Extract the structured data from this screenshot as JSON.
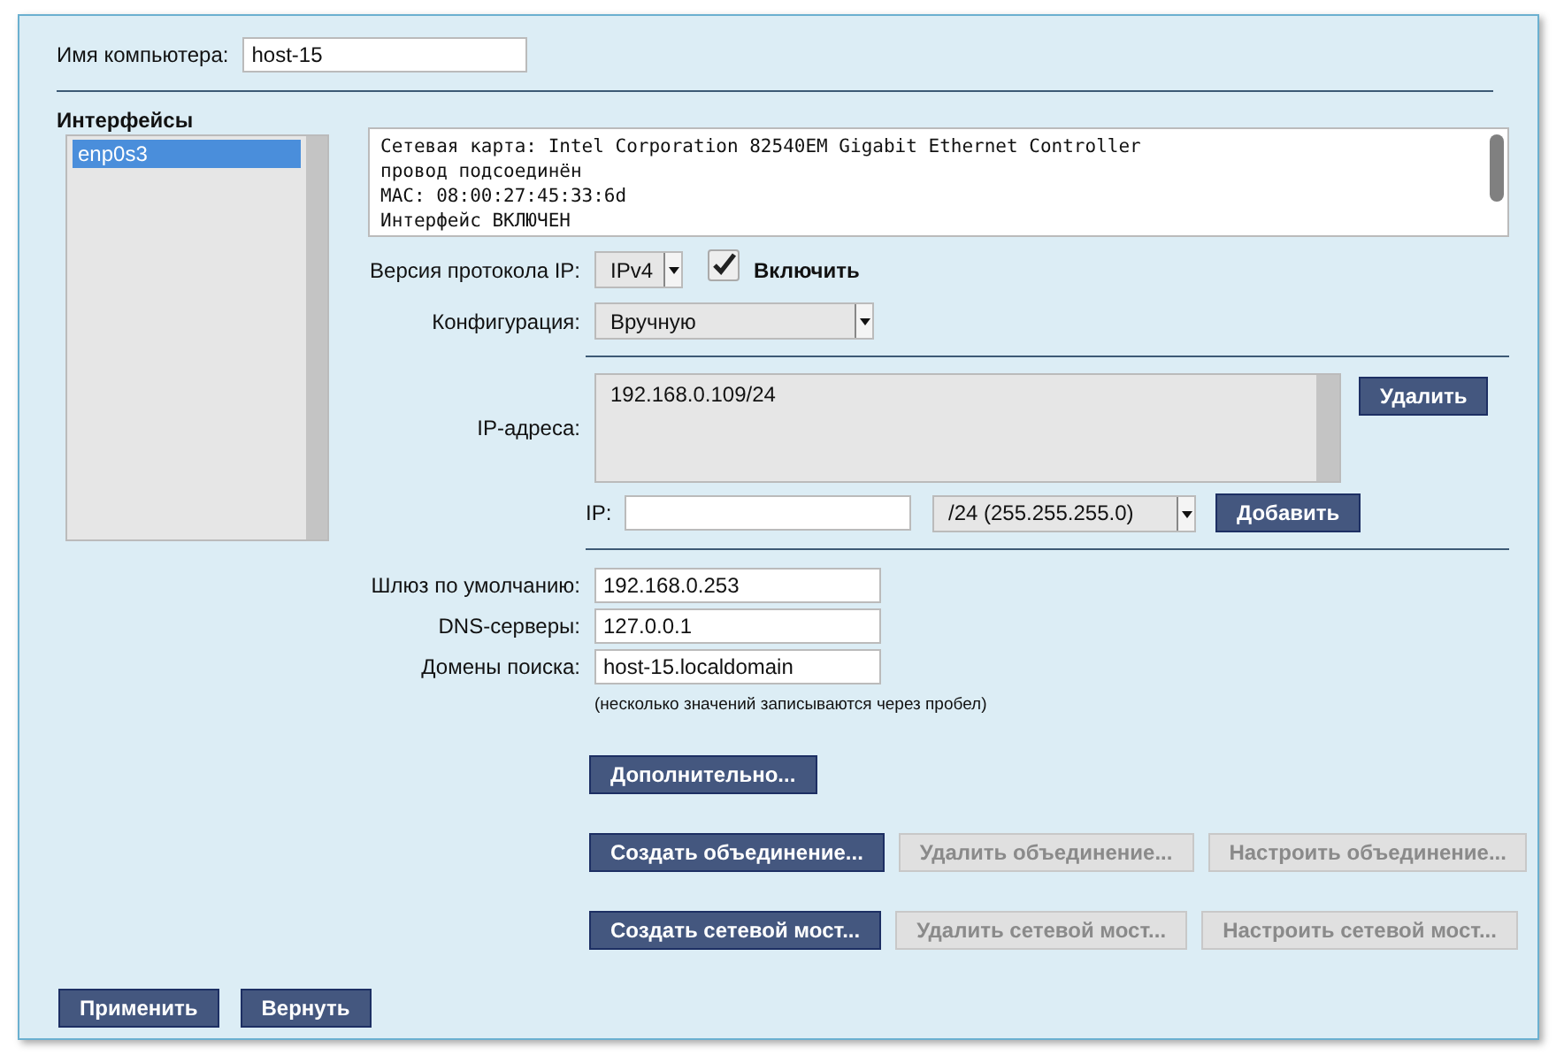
{
  "hostname": {
    "label": "Имя компьютера:",
    "value": "host-15"
  },
  "interfaces": {
    "title": "Интерфейсы",
    "items": [
      {
        "label": "enp0s3",
        "selected": true
      }
    ]
  },
  "info": [
    "Сетевая карта: Intel Corporation 82540EM Gigabit Ethernet Controller",
    "провод подсоединён",
    "MAC: 08:00:27:45:33:6d",
    "Интерфейс ВКЛЮЧЕН"
  ],
  "protocol": {
    "label": "Версия протокола IP:",
    "value": "IPv4",
    "enable": {
      "label": "Включить",
      "checked": true
    }
  },
  "config": {
    "label": "Конфигурация:",
    "value": "Вручную"
  },
  "addresses": {
    "label": "IP-адреса:",
    "items": [
      "192.168.0.109/24"
    ],
    "remove": {
      "label": "Удалить",
      "disabled": false
    }
  },
  "add_ip": {
    "label": "IP:",
    "mask": "/24 (255.255.255.0)",
    "add": {
      "label": "Добавить",
      "disabled": false
    }
  },
  "fields": [
    {
      "label": "Шлюз по умолчанию:",
      "value": "192.168.0.253"
    },
    {
      "label": "DNS-серверы:",
      "value": "127.0.0.1"
    },
    {
      "label": "Домены поиска:",
      "value": "host-15.localdomain"
    }
  ],
  "hint": "(несколько значений записываются через пробел)",
  "advanced": {
    "label": "Дополнительно...",
    "disabled": false
  },
  "button_rows": [
    [
      {
        "label": "Создать объединение...",
        "disabled": false
      },
      {
        "label": "Удалить объединение...",
        "disabled": true
      },
      {
        "label": "Настроить объединение...",
        "disabled": true
      }
    ],
    [
      {
        "label": "Создать сетевой мост...",
        "disabled": false
      },
      {
        "label": "Удалить сетевой мост...",
        "disabled": true
      },
      {
        "label": "Настроить сетевой мост...",
        "disabled": true
      }
    ]
  ],
  "footer": [
    {
      "label": "Применить",
      "disabled": false
    },
    {
      "label": "Вернуть",
      "disabled": false
    }
  ]
}
